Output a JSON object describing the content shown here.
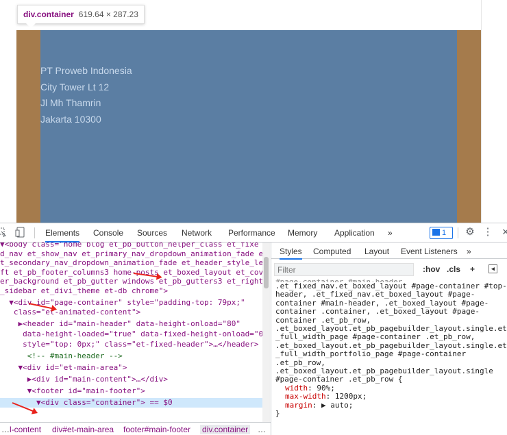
{
  "tooltip": {
    "tag": "div.container",
    "size": "619.64 × 287.23"
  },
  "footer": {
    "lines": [
      "PT Proweb Indonesia",
      "City Tower Lt 12",
      "Jl Mh Thamrin",
      "Jakarta 10300"
    ]
  },
  "toolbar": {
    "tabs": [
      "Elements",
      "Console",
      "Sources",
      "Network",
      "Performance",
      "Memory",
      "Application"
    ],
    "more": "»",
    "badge_count": "1",
    "gear": "⚙",
    "kebab": "⋮",
    "close": "✕"
  },
  "elements": {
    "lines": [
      "▼<body class=\"home blog et_pb_button_helper_class et_fixe",
      "d_nav et_show_nav et_primary_nav_dropdown_animation_fade e",
      "t_secondary_nav_dropdown_animation_fade et_header_style_le",
      "ft et_pb_footer_columns3 home-posts et_boxed_layout et_cov",
      "er_background et_pb_gutter windows et_pb_gutters3 et_right",
      "_sidebar et_divi_theme et-db chrome\">",
      "  ▼<div id=\"page-container\" style=\"padding-top: 79px;\"",
      "   class=\"et-animated-content\">",
      "    ▶<header id=\"main-header\" data-height-onload=\"80\"",
      "     data-height-loaded=\"true\" data-fixed-height-onload=\"0\"",
      "     style=\"top: 0px;\" class=\"et-fixed-header\">…</header>",
      "      <!-- #main-header -->",
      "    ▼<div id=\"et-main-area\">",
      "      ▶<div id=\"main-content\">…</div>",
      "      ▼<footer id=\"main-footer\">",
      "        ▼<div class=\"container\"> == $0"
    ]
  },
  "styles": {
    "tabs": [
      "Styles",
      "Computed",
      "Layout",
      "Event Listeners",
      "»"
    ],
    "filter_placeholder": "Filter",
    "hov": ":hov",
    "cls": ".cls",
    "plus": "+",
    "rules": [
      "#page-container #main-header,",
      ".et_fixed_nav.et_boxed_layout #page-container #top-",
      "header, .et_fixed_nav.et_boxed_layout #page-",
      "container #main-header, .et_boxed_layout #page-",
      "container .container, .et_boxed_layout #page-",
      "container .et_pb_row,",
      ".et_boxed_layout.et_pb_pagebuilder_layout.single.et",
      "_full_width_page #page-container .et_pb_row,",
      ".et_boxed_layout.et_pb_pagebuilder_layout.single.et",
      "_full_width_portfolio_page #page-container",
      ".et_pb_row,",
      ".et_boxed_layout.et_pb_pagebuilder_layout.single",
      "#page-container .et_pb_row {"
    ],
    "props": [
      {
        "name": "width",
        "value": "90%;"
      },
      {
        "name": "max-width",
        "value": "1200px;"
      },
      {
        "name": "margin",
        "value": "▶ auto;"
      }
    ],
    "close_brace": "}"
  },
  "breadcrumbs": [
    "…",
    "l-content",
    "div#et-main-area",
    "footer#main-footer",
    "div.container",
    "…"
  ],
  "colors": {
    "footer": "#5b7ea3",
    "padding": "#a57b4c",
    "accent": "#1a73e8"
  }
}
